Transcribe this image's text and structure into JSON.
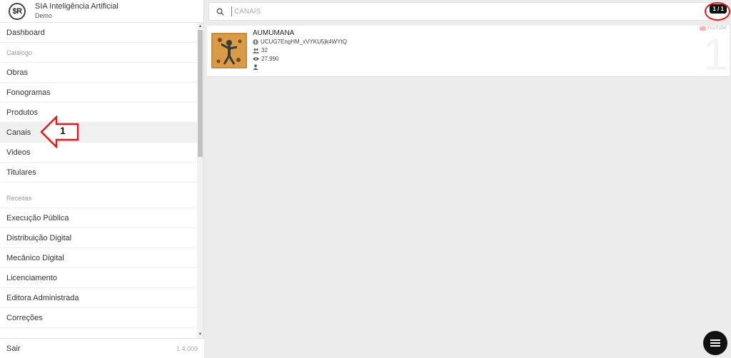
{
  "app": {
    "title": "SIA Inteligência Artificial",
    "subtitle": "Demo",
    "logo_text": "$R"
  },
  "menu": {
    "dashboard": "Dashboard",
    "section_catalog": "Catálogo",
    "obras": "Obras",
    "fonogramas": "Fonogramas",
    "produtos": "Produtos",
    "canais": "Canais",
    "videos": "Videos",
    "titulares": "Titulares",
    "section_revenue": "Receitas",
    "execucao": "Execução Pública",
    "distribuicao": "Distribuição Digital",
    "mecanico": "Mecânico Digital",
    "licenciamento": "Licenciamento",
    "editora": "Editora Administrada",
    "correcoes": "Correções"
  },
  "footer": {
    "logout": "Sair",
    "version": "1.4.009"
  },
  "annotation": {
    "number": "1",
    "color": "#e21b1b"
  },
  "search": {
    "placeholder": "CANAIS",
    "value": ""
  },
  "counter": "1 / 1",
  "channel": {
    "name": "AUMUMANA",
    "id": "UCUG7EngHM_xVYKU5jk4WYtQ",
    "subscribers": "32",
    "views": "27.990",
    "owner": "",
    "platform": "YouTube",
    "rank": "1"
  },
  "icons": [
    "search-icon",
    "globe-icon",
    "subscribers-icon",
    "eye-icon",
    "person-icon",
    "menu-icon",
    "youtube-icon"
  ]
}
